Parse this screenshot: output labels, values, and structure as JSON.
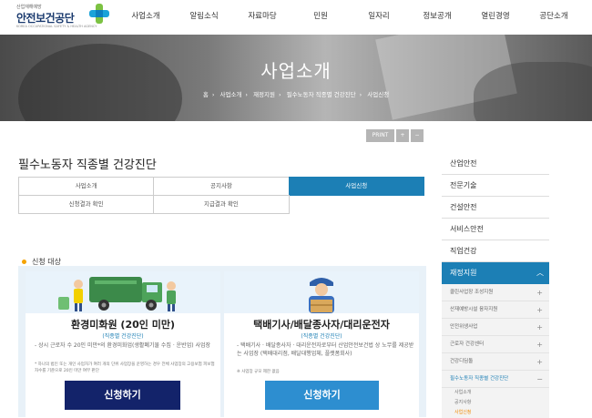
{
  "header": {
    "logo_sub": "산업재해예방",
    "logo_main": "안전보건공단",
    "logo_eng": "KOREA OCCUPATIONAL SAFETY & HEALTH AGENCY",
    "nav": [
      "사업소개",
      "알림소식",
      "자료마당",
      "민원",
      "일자리",
      "정보공개",
      "열린경영",
      "공단소개"
    ]
  },
  "hero": {
    "title": "사업소개",
    "breadcrumb": [
      "홈",
      "사업소개",
      "재정지원",
      "필수노동자 직종별 건강진단",
      "사업신청"
    ]
  },
  "tools": {
    "print": "PRINT",
    "zoom_in": "+",
    "zoom_out": "−"
  },
  "page_title": "필수노동자 직종별 건강진단",
  "tabs": [
    [
      "사업소개",
      "공지사항",
      "사업신청"
    ],
    [
      "신청결과 확인",
      "지급결과 확인"
    ]
  ],
  "section_label": "신청 대상",
  "card1": {
    "title": "환경미화원 (20인 미만)",
    "subtitle": "(직종별 건강진단)",
    "desc": "- 상시 근로자 수 20인 미만*의 환경미화업(생활폐기물 수집 · 운반업) 사업장",
    "note": "* 하나의 법인 또는 개인 사업자가 여러 개의 단위 사업장을 운영하는 경우 전체 사업장의 고용보험 피보험자수를 기준으로 20인 미만 여부 판단",
    "button": "신청하기"
  },
  "card2": {
    "title": "택배기사/배달종사자/대리운전자",
    "subtitle": "(직종별 건강진단)",
    "desc": "- 택배기사 · 배달종사자 · 대리운전자로부터 산업안전보건법 상 노무를 제공받는 사업장 (택배대리점, 배달대행업체, 플랫폼회사)",
    "note": "※ 사업장 규모 제한 없음",
    "button": "신청하기"
  },
  "lnb": {
    "items": [
      "산업안전",
      "전문기술",
      "건설안전",
      "서비스안전",
      "직업건강"
    ],
    "active": "재정지원",
    "active_icon": "chevron-up",
    "subs": [
      "클린사업장 조성지원",
      "산재예방시설 융자지원",
      "안전위생사업",
      "근로자 건강센터",
      "건강디딤돌",
      "필수노동자 직종별 건강진단"
    ],
    "sub_signs": [
      "+",
      "+",
      "+",
      "+",
      "+",
      "−"
    ],
    "subsubs": [
      "사업소개",
      "공지사항",
      "사업신청"
    ]
  },
  "colors": {
    "accent": "#1c7fb5",
    "navy": "#13236a",
    "orange": "#f5a300"
  }
}
